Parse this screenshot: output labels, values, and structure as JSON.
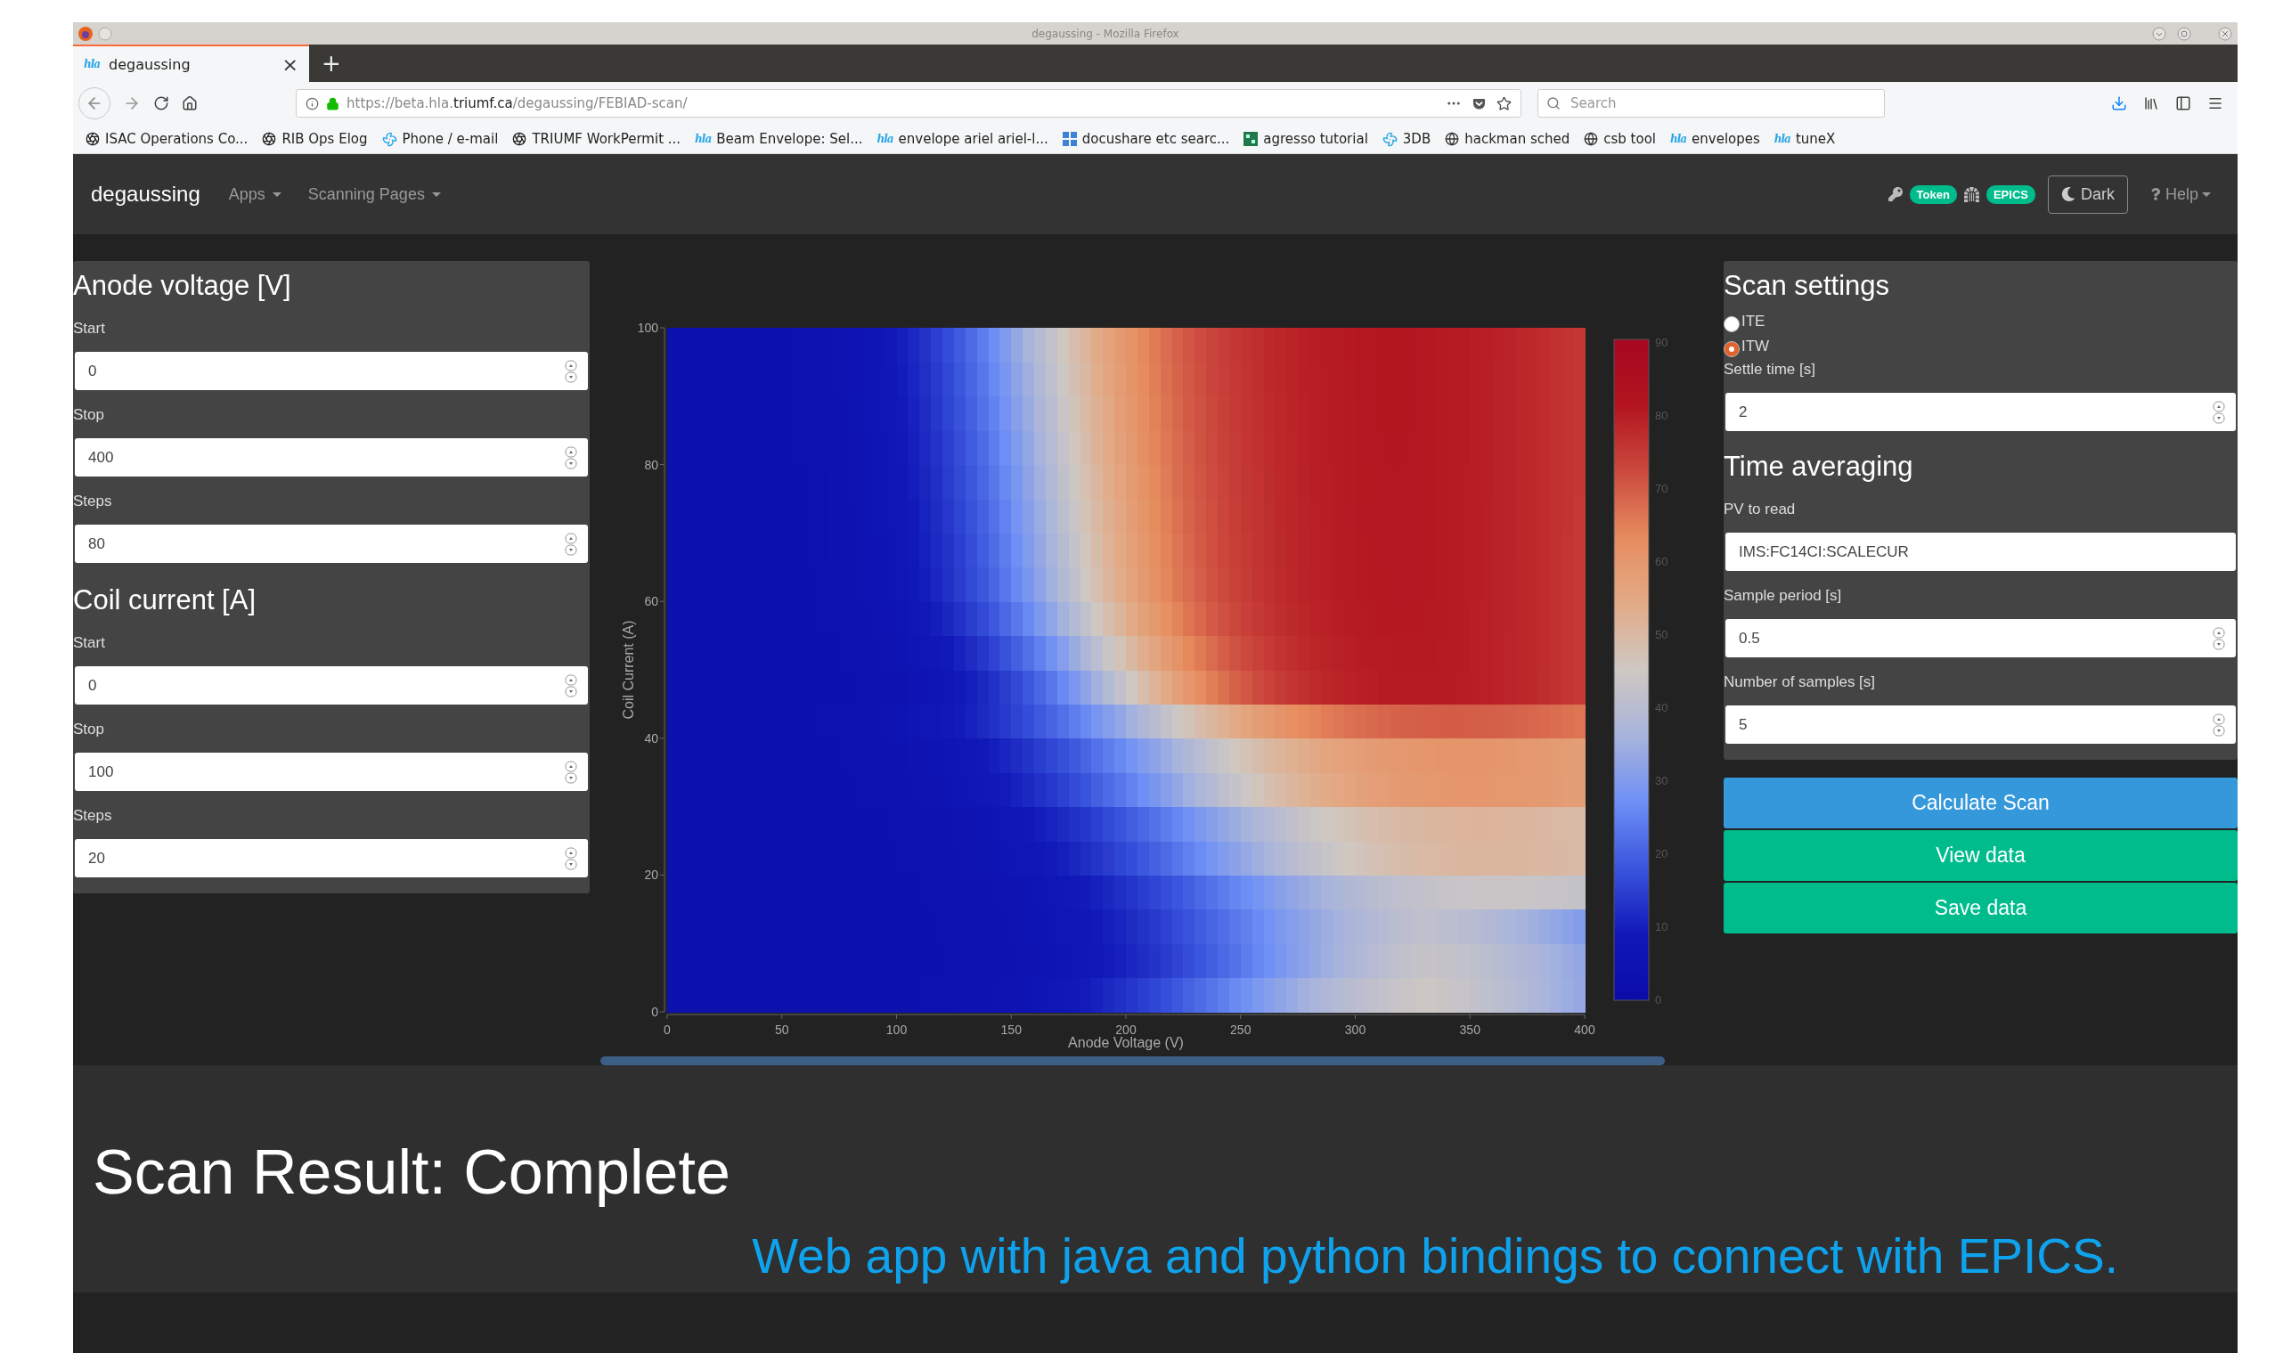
{
  "browser": {
    "window_title": "degaussing - Mozilla Firefox",
    "tab": {
      "logo": "hla",
      "title": "degaussing",
      "close": "×",
      "selected": true
    },
    "new_tab": "+",
    "url": "https://beta.hla.**triumf.ca**/degaussing/FEBIAD-scan/",
    "search": {
      "placeholder": "Search"
    },
    "bookmarks": [
      {
        "kind": "swirl",
        "label": "ISAC Operations Co..."
      },
      {
        "kind": "swirl",
        "label": "RIB Ops Elog"
      },
      {
        "kind": "fan",
        "label": "Phone / e-mail"
      },
      {
        "kind": "swirl",
        "label": "TRIUMF WorkPermit ..."
      },
      {
        "kind": "hla",
        "logo": "hla",
        "label": "Beam Envelope: Sel..."
      },
      {
        "kind": "hla",
        "logo": "hla",
        "label": "envelope ariel ariel-l..."
      },
      {
        "kind": "grid",
        "label": "docushare etc searc..."
      },
      {
        "kind": "sheet",
        "label": "agresso tutorial"
      },
      {
        "kind": "fan",
        "label": "3DB"
      },
      {
        "kind": "globe",
        "label": "hackman sched"
      },
      {
        "kind": "globe",
        "label": "csb tool"
      },
      {
        "kind": "hla",
        "logo": "hla",
        "label": "envelopes"
      },
      {
        "kind": "hla",
        "logo": "hla",
        "label": "tuneX"
      }
    ]
  },
  "navbar": {
    "brand": "degaussing",
    "menus": [
      {
        "label": "Apps"
      },
      {
        "label": "Scanning Pages"
      }
    ],
    "badges": [
      {
        "kind": "key",
        "label": "Token"
      },
      {
        "kind": "gate",
        "label": "EPICS"
      }
    ],
    "theme_button": "Dark",
    "help": "Help"
  },
  "left_panel": {
    "sections": [
      {
        "title": "Anode voltage [V]",
        "fields": [
          {
            "label": "Start",
            "value": "0"
          },
          {
            "label": "Stop",
            "value": "400"
          },
          {
            "label": "Steps",
            "value": "80"
          }
        ]
      },
      {
        "title": "Coil current [A]",
        "fields": [
          {
            "label": "Start",
            "value": "0"
          },
          {
            "label": "Stop",
            "value": "100"
          },
          {
            "label": "Steps",
            "value": "20"
          }
        ]
      }
    ]
  },
  "heatmap": {
    "xlabel": "Anode Voltage (V)",
    "ylabel": "Coil Current (A)",
    "xticks": [
      "0",
      "50",
      "100",
      "150",
      "200",
      "250",
      "300",
      "350",
      "400"
    ],
    "yticks": [
      "100",
      "80",
      "60",
      "40",
      "20",
      "0"
    ],
    "colorbar_ticks": [
      "90",
      "80",
      "70",
      "60",
      "50",
      "40",
      "30",
      "20",
      "10",
      "0"
    ]
  },
  "right_panel": {
    "title": "Scan settings",
    "radios": [
      {
        "label": "ITE",
        "selected": false
      },
      {
        "label": "ITW",
        "selected": true
      }
    ],
    "settle": {
      "label": "Settle time [s]",
      "value": "2"
    },
    "averaging_title": "Time averaging",
    "fields": [
      {
        "kind": "text",
        "label": "PV to read",
        "value": "IMS:FC14CI:SCALECUR"
      },
      {
        "kind": "number",
        "label": "Sample period [s]",
        "value": "0.5"
      },
      {
        "kind": "number",
        "label": "Number of samples [s]",
        "value": "5"
      }
    ]
  },
  "buttons": [
    {
      "kind": "primary",
      "label": "Calculate Scan"
    },
    {
      "kind": "success",
      "label": "View data"
    },
    {
      "kind": "success",
      "label": "Save data"
    }
  ],
  "result": {
    "title": "Scan Result: Complete",
    "caption": "Web app with java and python bindings to connect with EPICS."
  }
}
